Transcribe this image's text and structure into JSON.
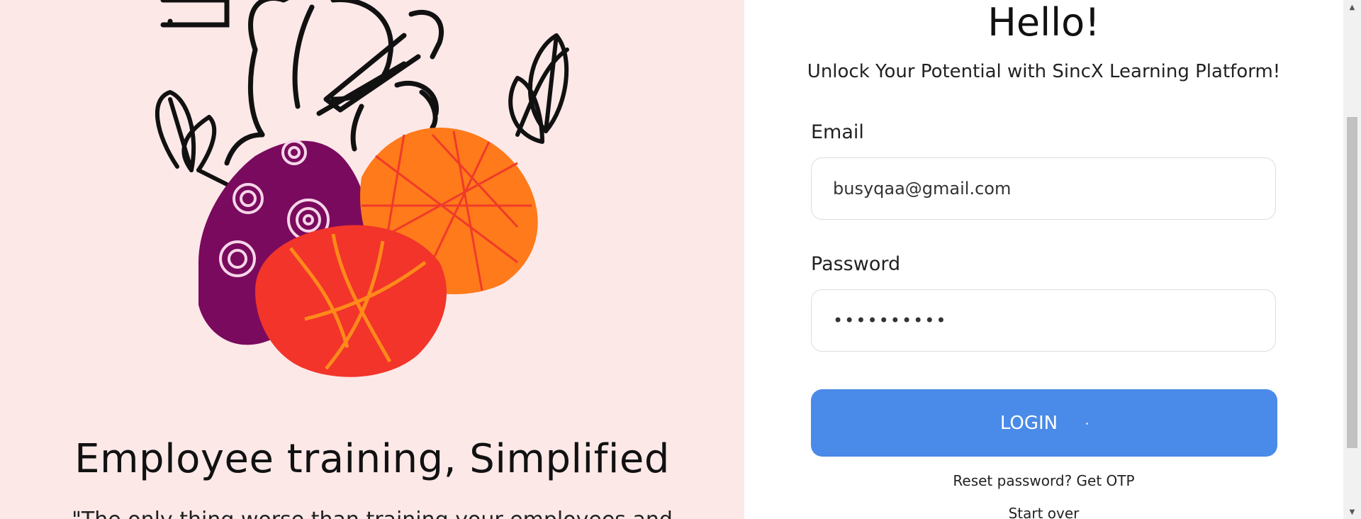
{
  "left": {
    "title": "Employee training, Simplified",
    "quote": "\"The only thing worse than training your employees and"
  },
  "form": {
    "greeting": "Hello!",
    "subtitle": "Unlock Your Potential with SincX Learning Platform!",
    "email_label": "Email",
    "email_value": "busyqaa@gmail.com",
    "password_label": "Password",
    "password_value": "••••••••••",
    "login_label": "LOGIN",
    "reset_link": "Reset password? Get OTP",
    "start_over_link": "Start over"
  },
  "colors": {
    "left_bg": "#fde8e8",
    "login_button": "#4a8ae8",
    "purple_blob": "#7a0a5e",
    "orange_blob": "#ff7a1a",
    "red_blob": "#f2342a"
  },
  "icons": {
    "scroll_up": "triangle-up-icon",
    "scroll_down": "triangle-down-icon"
  }
}
